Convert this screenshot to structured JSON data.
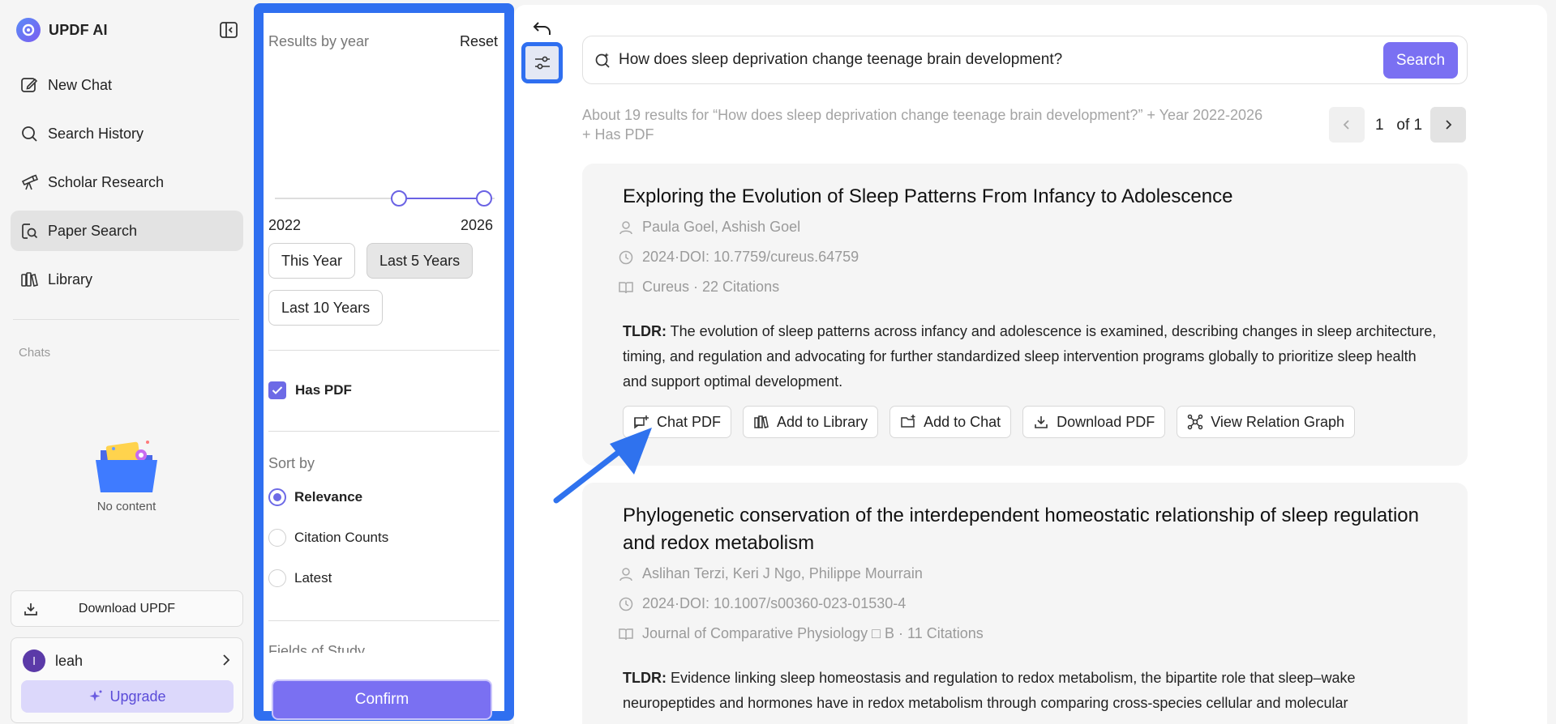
{
  "app": {
    "name": "UPDF AI"
  },
  "sidebar": {
    "items": [
      {
        "label": "New Chat",
        "icon": "edit-icon"
      },
      {
        "label": "Search History",
        "icon": "search-icon"
      },
      {
        "label": "Scholar Research",
        "icon": "telescope-icon"
      },
      {
        "label": "Paper Search",
        "icon": "paper-search-icon",
        "active": true
      },
      {
        "label": "Library",
        "icon": "library-icon"
      }
    ],
    "chats_label": "Chats",
    "empty_text": "No content",
    "download_label": "Download UPDF",
    "user": {
      "initial": "l",
      "name": "leah"
    },
    "upgrade_label": "Upgrade"
  },
  "filters": {
    "title": "Results by year",
    "reset_label": "Reset",
    "year_min": "2022",
    "year_max": "2026",
    "range_selected": [
      2022,
      2026
    ],
    "chips": [
      {
        "label": "This Year",
        "active": false
      },
      {
        "label": "Last 5 Years",
        "active": true
      },
      {
        "label": "Last 10 Years",
        "active": false
      }
    ],
    "has_pdf_label": "Has PDF",
    "has_pdf_checked": true,
    "sort_title": "Sort by",
    "sort_options": [
      {
        "label": "Relevance",
        "selected": true
      },
      {
        "label": "Citation Counts",
        "selected": false
      },
      {
        "label": "Latest",
        "selected": false
      }
    ],
    "next_section_label": "Fields of Study",
    "confirm_label": "Confirm"
  },
  "search": {
    "query": "How does sleep deprivation change teenage brain development?",
    "button_label": "Search"
  },
  "results": {
    "summary_line1": "About 19 results for   “How does sleep deprivation change teenage brain development?”   + Year 2022-2026",
    "summary_line2": "+ Has PDF",
    "page_current": "1",
    "page_total_label": "of 1"
  },
  "papers": [
    {
      "title": "Exploring the Evolution of Sleep Patterns From Infancy to Adolescence",
      "authors": "Paula Goel,  Ashish Goel",
      "date_doi": "2024·DOI: 10.7759/cureus.64759",
      "venue": "Cureus · 22 Citations",
      "tldr_label": "TLDR:",
      "tldr": " The evolution of sleep patterns across infancy and adolescence is examined, describing changes in sleep architecture, timing, and regulation and advocating for further standardized sleep intervention programs globally to prioritize sleep health and support optimal development."
    },
    {
      "title": "Phylogenetic conservation of the interdependent homeostatic relationship of sleep regulation and redox metabolism",
      "authors": "Aslihan Terzi,  Keri J Ngo,  Philippe Mourrain",
      "date_doi": "2024·DOI: 10.1007/s00360-023-01530-4",
      "venue": "Journal of Comparative Physiology □ B · 11 Citations",
      "tldr_label": "TLDR:",
      "tldr": " Evidence linking sleep homeostasis and regulation to redox metabolism, the bipartite role that sleep–wake neuropeptides and hormones have in redox metabolism through comparing cross-species cellular and molecular"
    }
  ],
  "actions": {
    "chat_pdf": "Chat PDF",
    "add_library": "Add to Library",
    "add_chat": "Add to Chat",
    "download_pdf": "Download PDF",
    "relation_graph": "View Relation Graph"
  },
  "colors": {
    "accent": "#7a70f2",
    "highlight": "#2f6ff0",
    "muted_text": "#9a9a9a"
  }
}
